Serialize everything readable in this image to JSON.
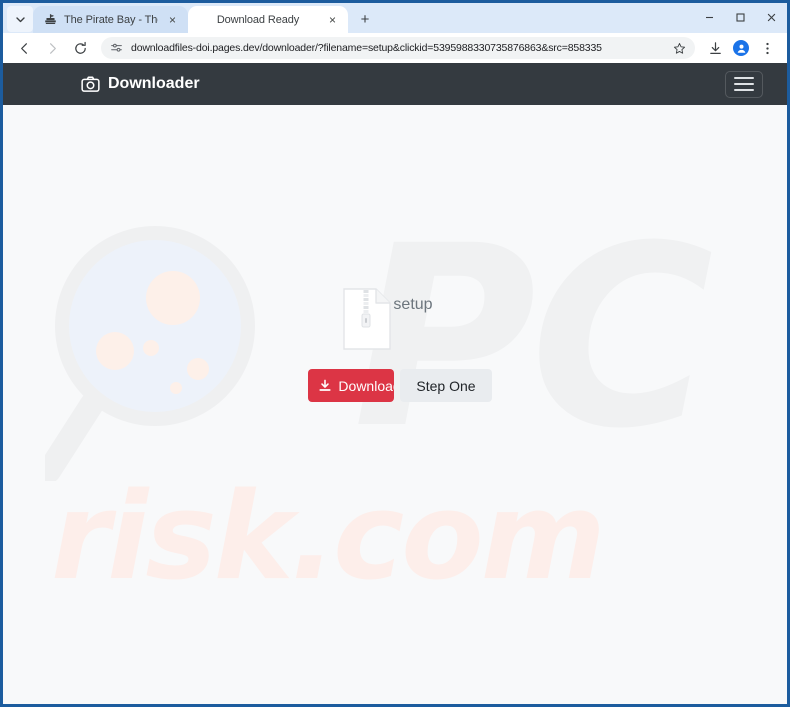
{
  "browser": {
    "tab_list_caret": "tab-search-caret",
    "tabs": [
      {
        "title": "The Pirate Bay - The galaxy's m",
        "active": false,
        "favicon": "pirate-ship-icon",
        "close_label": "×"
      },
      {
        "title": "Download Ready",
        "active": true,
        "favicon": "",
        "close_label": "×"
      }
    ],
    "new_tab_label": "+",
    "window_controls": {
      "minimize": "–",
      "maximize": "☐",
      "close": "✕"
    },
    "nav": {
      "back": "←",
      "forward": "→",
      "reload": "⟳"
    },
    "omnibox": {
      "url": "downloadfiles-doi.pages.dev/downloader/?filename=setup&clickid=5395988330735876863&src=858335",
      "site_settings_icon": "tune-sliders-icon",
      "bookmark_icon": "star-icon"
    },
    "toolbar_icons": [
      "downloads-icon",
      "profile-avatar-icon",
      "three-dot-menu-icon"
    ]
  },
  "page": {
    "navbar": {
      "brand_icon": "camera-icon",
      "brand_label": "Downloader",
      "menu_toggle": "hamburger-menu-icon",
      "background": "#343a40"
    },
    "download_card": {
      "file_icon": "zip-file-icon",
      "file_name": "setup",
      "download_button": {
        "label": "Download",
        "icon": "download-arrow-icon",
        "color": "#dc3545",
        "text_color": "#ffffff"
      },
      "step_button": {
        "label": "Step One",
        "color": "#e9ecef",
        "text_color": "#212529"
      }
    },
    "watermark": {
      "logo_icon": "magnifying-glass-watermark",
      "pc_text": "PC",
      "risk_text": "risk.com",
      "pc_color": "#f0f1f2",
      "risk_color": "#fdeeea"
    },
    "background": "#f8f9fa"
  }
}
